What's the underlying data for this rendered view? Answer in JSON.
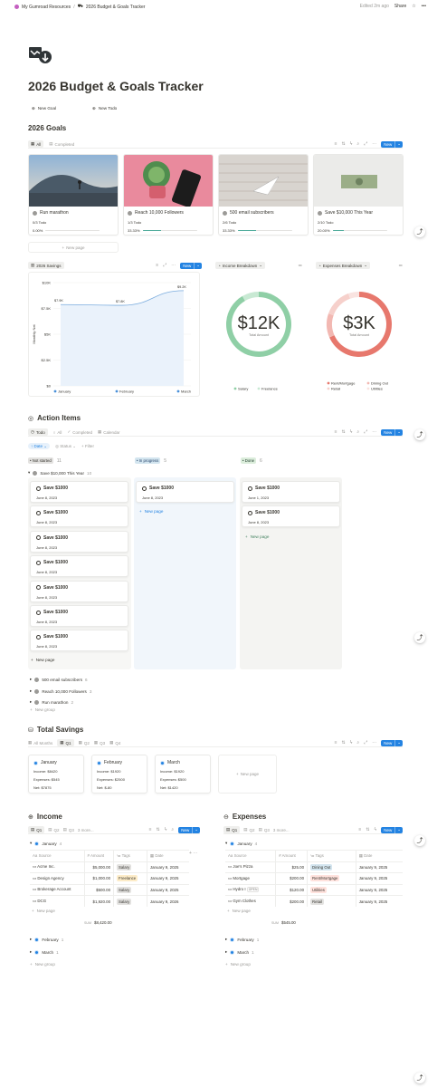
{
  "topbar": {
    "workspace": "My Gumroad Resources",
    "page": "2026 Budget & Goals Tracker",
    "edited": "Edited 2m ago",
    "share": "Share"
  },
  "page": {
    "title": "2026 Budget & Goals Tracker",
    "new_goal": "New Goal",
    "new_todo": "New Todo"
  },
  "goals": {
    "heading": "2026 Goals",
    "tab_all": "All",
    "tab_completed": "Completed",
    "new_btn": "New",
    "new_page": "New page",
    "cards": [
      {
        "title": "Run marathon",
        "todo": "0/3 Todo",
        "pct": "0.00%",
        "fill": 0
      },
      {
        "title": "Reach 10,000 Followers",
        "todo": "1/3 Todo",
        "pct": "33.33%",
        "fill": 0.3333
      },
      {
        "title": "500 email subscribers",
        "todo": "2/6 Todo",
        "pct": "33.33%",
        "fill": 0.3333
      },
      {
        "title": "Save $10,000 This Year",
        "todo": "2/10 Todo",
        "pct": "20.00%",
        "fill": 0.2
      }
    ]
  },
  "savings_chart": {
    "tab": "2026 Savings",
    "new_btn": "New",
    "ylabel": "Monthly Net",
    "yticks": [
      "$10K",
      "$7.5K",
      "$5K",
      "$2.5K",
      "$0"
    ],
    "legend": [
      "January",
      "February",
      "March"
    ]
  },
  "income_breakdown": {
    "tab": "Income Breakdown",
    "center_value": "$12K",
    "center_label": "Total Amount",
    "legend": [
      "Salary",
      "Freelance"
    ]
  },
  "expenses_breakdown": {
    "tab": "Expenses Breakdown",
    "center_value": "$3K",
    "center_label": "Total Amount",
    "legend": [
      "Rent/Mortgage",
      "Dining Out",
      "Retail",
      "Utilities"
    ]
  },
  "chart_data": [
    {
      "type": "area",
      "title": "",
      "x": [
        "January",
        "February",
        "March"
      ],
      "series": [
        {
          "values": [
            7875,
            7800,
            9220
          ]
        }
      ],
      "data_labels": [
        "$7.9K",
        "$7.8K",
        "$9.2K"
      ],
      "ylabel": "Monthly Net",
      "ylim": [
        0,
        10000
      ],
      "yticks": [
        "$10K",
        "$7.5K",
        "$5K",
        "$2.5K",
        "$0"
      ],
      "grid": true
    },
    {
      "type": "pie",
      "title": "",
      "categories": [
        "Salary",
        "Freelance"
      ],
      "values": [
        10920,
        1000
      ],
      "colors": [
        "#8fcfa6",
        "#c8e9d3"
      ]
    },
    {
      "type": "pie",
      "title": "",
      "categories": [
        "Rent/Mortgage",
        "Dining Out",
        "Retail",
        "Utilities"
      ],
      "values": [
        2400,
        420,
        500,
        190
      ],
      "colors": [
        "#e7786d",
        "#f2b8b2",
        "#f6d0cb",
        "#f9e3e0"
      ]
    }
  ],
  "actions": {
    "heading": "Action Items",
    "tabs": [
      "Todo",
      "All",
      "Completed",
      "Calendar"
    ],
    "new_btn": "New",
    "filters": {
      "date": "Date",
      "status": "Status",
      "filter": "Filter"
    },
    "columns": [
      {
        "label": "Not started",
        "count": "11"
      },
      {
        "label": "In progress",
        "count": "5"
      },
      {
        "label": "Done",
        "count": "6"
      }
    ],
    "group": {
      "label": "Save $10,000 This Year",
      "count": "10"
    },
    "not_started": [
      {
        "title": "Save $1000",
        "date": "June 8, 2023"
      },
      {
        "title": "Save $1000",
        "date": "June 8, 2023"
      },
      {
        "title": "Save $1000",
        "date": "June 8, 2023"
      },
      {
        "title": "Save $1000",
        "date": "June 8, 2023"
      },
      {
        "title": "Save $1000",
        "date": "June 8, 2023"
      },
      {
        "title": "Save $1000",
        "date": "June 8, 2023"
      },
      {
        "title": "Save $1000",
        "date": "June 8, 2023"
      }
    ],
    "in_progress": [
      {
        "title": "Save $1000",
        "date": "June 8, 2023"
      }
    ],
    "done": [
      {
        "title": "Save $1000",
        "date": "June 1, 2023"
      },
      {
        "title": "Save $1000",
        "date": "June 8, 2023"
      }
    ],
    "new_page": "New page",
    "other_groups": [
      {
        "label": "500 email subscribers",
        "count": "6"
      },
      {
        "label": "Reach 10,000 Followers",
        "count": "3"
      },
      {
        "label": "Run marathon",
        "count": "2"
      }
    ],
    "new_group": "New group"
  },
  "savings": {
    "heading": "Total Savings",
    "tabs": [
      "All Months",
      "Q1",
      "Q2",
      "Q3",
      "Q4"
    ],
    "new_btn": "New",
    "new_page": "New page",
    "months": [
      {
        "name": "January",
        "income": "Income: $8420",
        "expenses": "Expenses: $545",
        "net": "Net: $7875"
      },
      {
        "name": "February",
        "income": "Income: $1920",
        "expenses": "Expenses: $2500",
        "net": "Net: $-80"
      },
      {
        "name": "March",
        "income": "Income: $1920",
        "expenses": "Expenses: $500",
        "net": "Net: $1420"
      }
    ]
  },
  "income": {
    "heading": "Income",
    "tabs": [
      "Q1",
      "Q2",
      "Q3",
      "3 more..."
    ],
    "new_btn": "New",
    "group": "January",
    "group_count": "4",
    "headers": [
      "Source",
      "Amount",
      "Tags",
      "Date"
    ],
    "rows": [
      {
        "source": "Acme Inc.",
        "amount": "$5,000.00",
        "tag": "Salary",
        "date": "January 9, 2025"
      },
      {
        "source": "Design Agency",
        "amount": "$1,000.00",
        "tag": "Freelance",
        "date": "January 9, 2025"
      },
      {
        "source": "Brokerage Account",
        "amount": "$500.00",
        "tag": "Salary",
        "date": "January 9, 2025"
      },
      {
        "source": "DCG",
        "amount": "$1,920.00",
        "tag": "Salary",
        "date": "January 9, 2026"
      }
    ],
    "new_page": "New page",
    "sum_label": "SUM",
    "sum": "$8,420.00",
    "other_groups": [
      {
        "label": "February",
        "count": "1"
      },
      {
        "label": "March",
        "count": "1"
      }
    ],
    "new_group": "New group"
  },
  "expenses": {
    "heading": "Expenses",
    "tabs": [
      "Q1",
      "Q2",
      "Q3",
      "3 more..."
    ],
    "new_btn": "New",
    "group": "January",
    "group_count": "4",
    "headers": [
      "Source",
      "Amount",
      "Tags",
      "Date"
    ],
    "rows": [
      {
        "source": "Joe's Pizza",
        "amount": "$25.00",
        "tag": "Dining Out",
        "date": "January 9, 2025"
      },
      {
        "source": "Mortgage",
        "amount": "$200.00",
        "tag": "Rent/Mortgage",
        "date": "January 9, 2025"
      },
      {
        "source": "Hydro I",
        "open": "OPEN",
        "amount": "$120.00",
        "tag": "Utilities",
        "date": "January 9, 2025"
      },
      {
        "source": "Gym Clothes",
        "amount": "$200.00",
        "tag": "Retail",
        "date": "January 9, 2025"
      }
    ],
    "new_page": "New page",
    "sum_label": "SUM",
    "sum": "$545.00",
    "other_groups": [
      {
        "label": "February",
        "count": "1"
      },
      {
        "label": "March",
        "count": "1"
      }
    ],
    "new_group": "New group"
  }
}
